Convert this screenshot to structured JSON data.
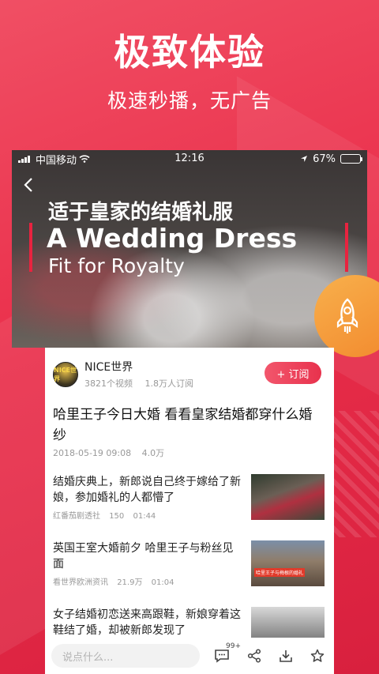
{
  "promo": {
    "headline": "极致体验",
    "subline": "极速秒播，无广告"
  },
  "status_bar": {
    "carrier": "中国移动",
    "time": "12:16",
    "battery": "67%",
    "battery_level": 0.67
  },
  "video": {
    "title_cn": "适于皇家的结婚礼服",
    "title_en_line1": "A Wedding Dress",
    "title_en_line2": "Fit for Royalty"
  },
  "channel": {
    "name": "NICE世界",
    "avatar_text": "NICE世界",
    "videos": "3821个视频",
    "subscribers": "1.8万人订阅",
    "subscribe_label": "+ 订阅"
  },
  "main": {
    "title": "哈里王子今日大婚 看看皇家结婚都穿什么婚纱",
    "date": "2018-05-19 09:08",
    "views": "4.0万"
  },
  "related": [
    {
      "title": "结婚庆典上，新郎说自己终于嫁给了新娘，参加婚礼的人都懵了",
      "source": "红番茄剧透社",
      "views": "150",
      "duration": "01:44"
    },
    {
      "title": "英国王室大婚前夕 哈里王子与粉丝见面",
      "source": "看世界欧洲资讯",
      "views": "21.9万",
      "duration": "01:04",
      "thumb_tag": "哈里王子与梅根的婚礼"
    },
    {
      "title": "女子结婚初恋送来高跟鞋，新娘穿着这鞋结了婚，却被新郎发现了",
      "source": "",
      "views": "",
      "duration": ""
    }
  ],
  "bottom_bar": {
    "comment_placeholder": "说点什么...",
    "comment_count": "99+"
  },
  "colors": {
    "accent": "#e8324d",
    "rocket": "#f28a2e"
  },
  "icons": [
    "back-icon",
    "rocket-icon",
    "comment-icon",
    "share-icon",
    "download-icon",
    "star-icon",
    "wifi-icon",
    "location-icon"
  ]
}
